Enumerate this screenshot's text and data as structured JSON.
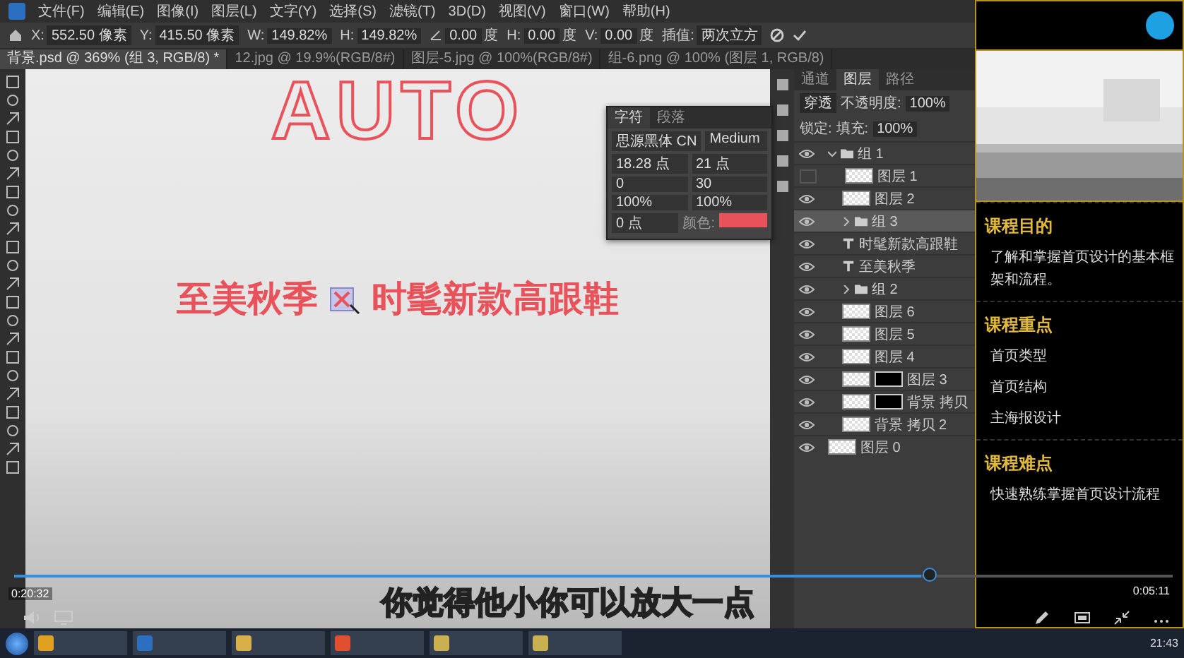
{
  "photoshop": {
    "menu": [
      "文件(F)",
      "编辑(E)",
      "图像(I)",
      "图层(L)",
      "文字(Y)",
      "选择(S)",
      "滤镜(T)",
      "3D(D)",
      "视图(V)",
      "窗口(W)",
      "帮助(H)"
    ],
    "options": [
      {
        "kind": "field",
        "label": "X:",
        "value": "552.50 像素"
      },
      {
        "kind": "field",
        "label": "Y:",
        "value": "415.50 像素"
      },
      {
        "kind": "field",
        "label": "W:",
        "value": "149.82%"
      },
      {
        "kind": "field",
        "label": "H:",
        "value": "149.82%"
      },
      {
        "kind": "angle",
        "value": "0.00",
        "unit": "度"
      },
      {
        "kind": "field",
        "label": "H:",
        "value": "0.00",
        "unit": "度"
      },
      {
        "kind": "field",
        "label": "V:",
        "value": "0.00",
        "unit": "度"
      },
      {
        "kind": "field",
        "label": "插值:",
        "value": "两次立方"
      }
    ],
    "doc_tabs": [
      {
        "label": "背景.psd @ 369% (组 3, RGB/8) *",
        "selected": true
      },
      {
        "label": "12.jpg @ 19.9%(RGB/8#)",
        "selected": false
      },
      {
        "label": "图层-5.jpg @ 100%(RGB/8#)",
        "selected": false
      },
      {
        "label": "组-6.png @ 100% (图层 1, RGB/8)",
        "selected": false
      }
    ],
    "canvas": {
      "headline": "AUTO",
      "text_before": "至美秋季",
      "text_after": "时髦新款高跟鞋"
    },
    "character_panel": {
      "tabs": [
        {
          "label": "字符",
          "selected": true
        },
        {
          "label": "段落",
          "selected": false
        }
      ],
      "font": "思源黑体 CN",
      "style": "Medium",
      "size": "18.28 点",
      "leading": "21 点",
      "kerning": "0",
      "tracking": "30",
      "scale_v": "100%",
      "scale_h": "100%",
      "baseline": "0 点",
      "color_label": "颜色:",
      "color": "#e8525a"
    },
    "layers_panel": {
      "tabs": [
        {
          "label": "通道",
          "selected": false
        },
        {
          "label": "图层",
          "selected": true
        },
        {
          "label": "路径",
          "selected": false
        }
      ],
      "blend": "穿透",
      "opacity_label": "不透明度:",
      "opacity": "100%",
      "lock_label": "锁定:",
      "fill_label": "填充:",
      "fill": "100%",
      "layers": [
        {
          "kind": "group",
          "name": "组 1",
          "visible": true,
          "selected": false,
          "expanded": true,
          "children": [
            {
              "kind": "layer",
              "name": "图层 1",
              "visible": false,
              "selected": false
            },
            {
              "kind": "layer",
              "name": "图层 2",
              "visible": true,
              "selected": false
            },
            {
              "kind": "group",
              "name": "组 3",
              "visible": true,
              "selected": true,
              "expanded": false
            },
            {
              "kind": "text",
              "name": "时髦新款高跟鞋",
              "visible": true,
              "selected": false
            },
            {
              "kind": "text",
              "name": "至美秋季",
              "visible": true,
              "selected": false
            },
            {
              "kind": "group",
              "name": "组 2",
              "visible": true,
              "selected": false,
              "expanded": false
            },
            {
              "kind": "layer",
              "name": "图层 6",
              "visible": true,
              "selected": false
            },
            {
              "kind": "layer",
              "name": "图层 5",
              "visible": true,
              "selected": false
            },
            {
              "kind": "layer",
              "name": "图层 4",
              "visible": true,
              "selected": false
            },
            {
              "kind": "masked",
              "name": "图层 3",
              "visible": true,
              "selected": false
            },
            {
              "kind": "masked",
              "name": "背景 拷贝",
              "visible": true,
              "selected": false
            },
            {
              "kind": "layer",
              "name": "背景 拷贝 2",
              "visible": true,
              "selected": false
            }
          ]
        },
        {
          "kind": "layer",
          "name": "图层 0",
          "visible": true,
          "selected": false
        }
      ]
    }
  },
  "sidebar": {
    "sections": [
      {
        "title": "课程目的",
        "items": [
          "了解和掌握首页设计的基本框架和流程。"
        ]
      },
      {
        "title": "课程重点",
        "items": [
          "首页类型",
          "首页结构",
          "主海报设计"
        ]
      },
      {
        "title": "课程难点",
        "items": [
          "快速熟练掌握首页设计流程"
        ]
      }
    ]
  },
  "player": {
    "elapsed": "0:20:32",
    "total": "0:05:11",
    "progress": {
      "level": 0.79
    },
    "subtitle": "你觉得他小你可以放大一点"
  },
  "taskbar": {
    "clock": "21:43"
  }
}
